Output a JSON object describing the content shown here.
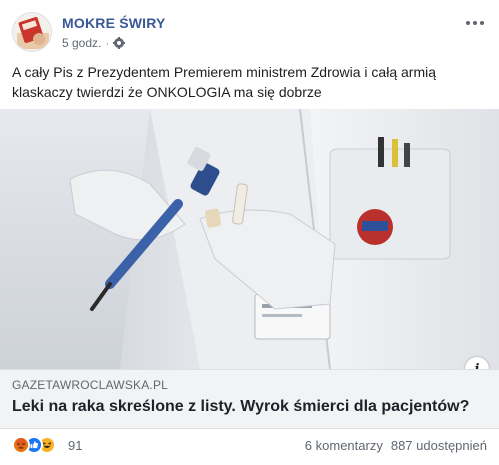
{
  "post": {
    "page_name": "MOKRE ŚWIRY",
    "time": "5 godz.",
    "separator": "·",
    "privacy_icon": "globe-icon",
    "text": "A cały Pis z Prezydentem Premierem ministrem Zdrowia i całą armią klaskaczy twierdzi że ONKOLOGIA ma się dobrze"
  },
  "link": {
    "domain": "GAZETAWROCLAWSKA.PL",
    "title": "Leki na raka skreślone z listy. Wyrok śmierci dla pacjentów?",
    "info_label": "i"
  },
  "footer": {
    "reactions": [
      "angry-reaction-icon",
      "like-reaction-icon",
      "haha-reaction-icon"
    ],
    "reaction_count": "91",
    "comments": "6 komentarzy",
    "shares": "887 udostępnień"
  },
  "colors": {
    "page_name": "#385898",
    "meta": "#616770",
    "caption_bg": "#f2f3f5",
    "like": "#1877f2",
    "angry": "#e9710f",
    "haha": "#f7b125"
  }
}
